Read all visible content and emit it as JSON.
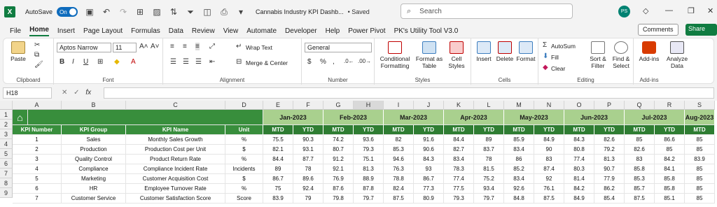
{
  "titlebar": {
    "app_letter": "X",
    "autosave_label": "AutoSave",
    "autosave_state": "On",
    "doc_title": "Cannabis Industry KPI Dashb...",
    "saved_status": "• Saved",
    "search_placeholder": "Search",
    "user_initials": "PS"
  },
  "tabs": [
    "File",
    "Home",
    "Insert",
    "Page Layout",
    "Formulas",
    "Data",
    "Review",
    "View",
    "Automate",
    "Developer",
    "Help",
    "Power Pivot",
    "PK's Utility Tool V3.0"
  ],
  "active_tab": "Home",
  "comments_label": "Comments",
  "share_label": "Share",
  "ribbon": {
    "clipboard": {
      "label": "Clipboard",
      "paste": "Paste"
    },
    "font": {
      "label": "Font",
      "name": "Aptos Narrow",
      "size": "11"
    },
    "alignment": {
      "label": "Alignment",
      "wrap": "Wrap Text",
      "merge": "Merge & Center"
    },
    "number": {
      "label": "Number",
      "format": "General"
    },
    "styles": {
      "label": "Styles",
      "cond": "Conditional Formatting",
      "fmt_table": "Format as Table",
      "cell_styles": "Cell Styles"
    },
    "cells": {
      "label": "Cells",
      "insert": "Insert",
      "delete": "Delete",
      "format": "Format"
    },
    "editing": {
      "label": "Editing",
      "autosum": "AutoSum",
      "fill": "Fill",
      "clear": "Clear",
      "sort": "Sort & Filter",
      "find": "Find & Select"
    },
    "addins": {
      "label": "Add-ins",
      "addins": "Add-ins",
      "analyze": "Analyze Data"
    }
  },
  "formula_bar": {
    "namebox": "H18",
    "fx": "fx",
    "content": ""
  },
  "columns": [
    "A",
    "B",
    "C",
    "D",
    "E",
    "F",
    "G",
    "H",
    "I",
    "J",
    "K",
    "L",
    "M",
    "N",
    "O",
    "P",
    "Q",
    "R",
    "S"
  ],
  "selected_column": "H",
  "row_numbers": [
    "1",
    "2",
    "3",
    "4",
    "5",
    "6",
    "7",
    "8",
    "9"
  ],
  "headers": {
    "kpi_number": "KPI Number",
    "kpi_group": "KPI Group",
    "kpi_name": "KPI Name",
    "unit": "Unit"
  },
  "months": [
    "Jan-2023",
    "Feb-2023",
    "Mar-2023",
    "Apr-2023",
    "May-2023",
    "Jun-2023",
    "Jul-2023",
    "Aug-2023"
  ],
  "subheaders": [
    "MTD",
    "YTD"
  ],
  "rows": [
    {
      "num": "1",
      "group": "Sales",
      "name": "Monthly Sales Growth",
      "unit": "%",
      "vals": [
        "75.5",
        "90.3",
        "74.2",
        "93.6",
        "82",
        "91.6",
        "84.4",
        "89",
        "85.9",
        "84.9",
        "84.3",
        "82.6",
        "85",
        "86.6",
        "85"
      ]
    },
    {
      "num": "2",
      "group": "Production",
      "name": "Production Cost per Unit",
      "unit": "$",
      "vals": [
        "82.1",
        "93.1",
        "80.7",
        "79.3",
        "85.3",
        "90.6",
        "82.7",
        "83.7",
        "83.4",
        "90",
        "80.8",
        "79.2",
        "82.6",
        "85",
        "85"
      ]
    },
    {
      "num": "3",
      "group": "Quality Control",
      "name": "Product Return Rate",
      "unit": "%",
      "vals": [
        "84.4",
        "87.7",
        "91.2",
        "75.1",
        "94.6",
        "84.3",
        "83.4",
        "78",
        "86",
        "83",
        "77.4",
        "81.3",
        "83",
        "84.2",
        "83.9"
      ]
    },
    {
      "num": "4",
      "group": "Compliance",
      "name": "Compliance Incident Rate",
      "unit": "Incidents",
      "vals": [
        "89",
        "78",
        "92.1",
        "81.3",
        "76.3",
        "93",
        "78.3",
        "81.5",
        "85.2",
        "87.4",
        "80.3",
        "90.7",
        "85.8",
        "84.1",
        "85"
      ]
    },
    {
      "num": "5",
      "group": "Marketing",
      "name": "Customer Acquisition Cost",
      "unit": "$",
      "vals": [
        "86.7",
        "89.6",
        "76.9",
        "88.9",
        "78.8",
        "86.7",
        "77.4",
        "75.2",
        "83.4",
        "92",
        "81.4",
        "77.9",
        "85.3",
        "85.8",
        "85"
      ]
    },
    {
      "num": "6",
      "group": "HR",
      "name": "Employee Turnover Rate",
      "unit": "%",
      "vals": [
        "75",
        "92.4",
        "87.6",
        "87.8",
        "82.4",
        "77.3",
        "77.5",
        "93.4",
        "92.6",
        "76.1",
        "84.2",
        "86.2",
        "85.7",
        "85.8",
        "85"
      ]
    },
    {
      "num": "7",
      "group": "Customer Service",
      "name": "Customer Satisfaction Score",
      "unit": "Score",
      "vals": [
        "83.9",
        "79",
        "79.8",
        "79.7",
        "87.5",
        "80.9",
        "79.3",
        "79.7",
        "84.8",
        "87.5",
        "84.9",
        "85.4",
        "87.5",
        "85.1",
        "85"
      ]
    }
  ]
}
